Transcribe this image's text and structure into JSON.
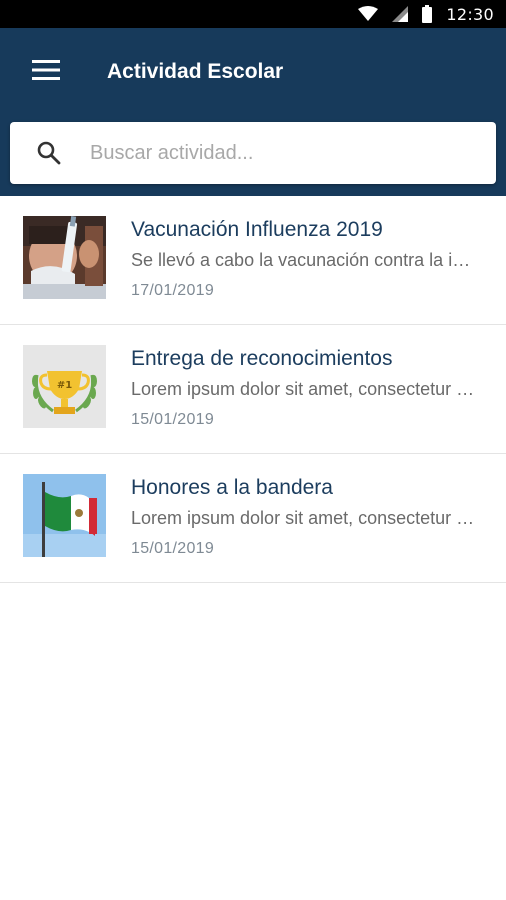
{
  "status_bar": {
    "time": "12:30"
  },
  "app_bar": {
    "title": "Actividad Escolar"
  },
  "search": {
    "placeholder": "Buscar actividad...",
    "value": ""
  },
  "activities": [
    {
      "title": "Vacunación Influenza 2019",
      "description": "Se llevó a cabo la vacunación contra la influenza",
      "date": "17/01/2019",
      "thumbnail": "vaccination-photo"
    },
    {
      "title": "Entrega de reconocimientos",
      "description": "Lorem ipsum dolor sit amet, consectetur adipiscing elit",
      "date": "15/01/2019",
      "thumbnail": "trophy-icon"
    },
    {
      "title": "Honores a la bandera",
      "description": "Lorem ipsum dolor sit amet, consectetur adipiscing elit",
      "date": "15/01/2019",
      "thumbnail": "mexican-flag-photo"
    }
  ],
  "colors": {
    "app_bar": "#173a5b",
    "title_text": "#1c3d5e",
    "status_bar": "#000000"
  }
}
